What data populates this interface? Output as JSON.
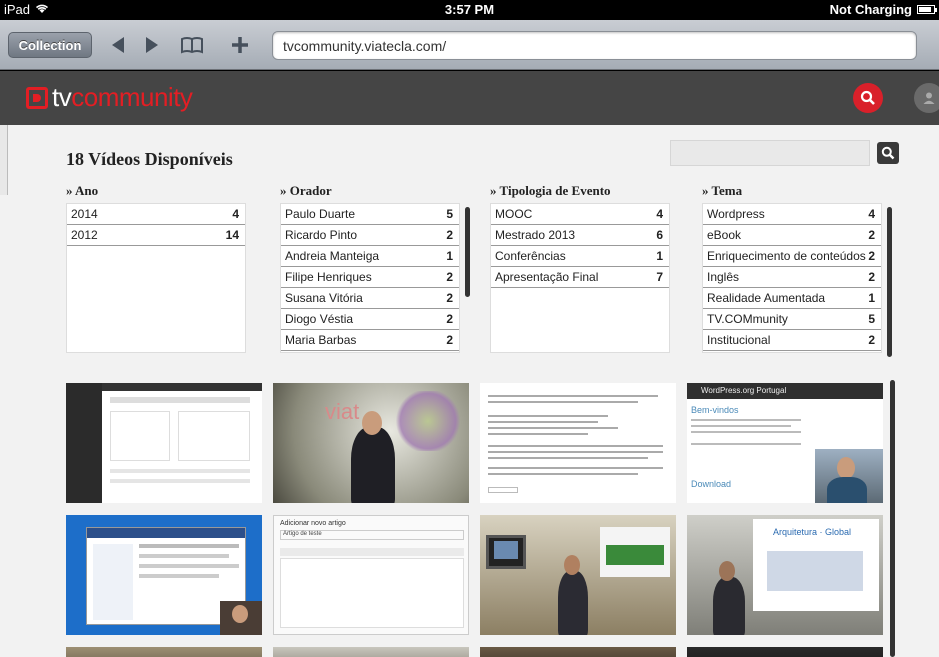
{
  "status_bar": {
    "device": "iPad",
    "time": "3:57 PM",
    "battery_status": "Not Charging"
  },
  "browser": {
    "collection_label": "Collection",
    "url": "tvcommunity.viatecla.com/"
  },
  "site": {
    "logo_prefix": "tv",
    "logo_name": "community",
    "accent_color": "#e31e24"
  },
  "main": {
    "heading": "18 Vídeos Disponíveis",
    "search_placeholder": ""
  },
  "facets": [
    {
      "title": "» Ano",
      "items": [
        {
          "label": "2014",
          "count": "4"
        },
        {
          "label": "2012",
          "count": "14"
        }
      ]
    },
    {
      "title": "» Orador",
      "items": [
        {
          "label": "Paulo Duarte",
          "count": "5"
        },
        {
          "label": "Ricardo Pinto",
          "count": "2"
        },
        {
          "label": "Andreia Manteiga",
          "count": "1"
        },
        {
          "label": "Filipe Henriques",
          "count": "2"
        },
        {
          "label": "Susana Vitória",
          "count": "2"
        },
        {
          "label": "Diogo Véstia",
          "count": "2"
        },
        {
          "label": "Maria Barbas",
          "count": "2"
        }
      ]
    },
    {
      "title": "» Tipologia de Evento",
      "items": [
        {
          "label": "MOOC",
          "count": "4"
        },
        {
          "label": "Mestrado 2013",
          "count": "6"
        },
        {
          "label": "Conferências",
          "count": "1"
        },
        {
          "label": "Apresentação Final",
          "count": "7"
        }
      ]
    },
    {
      "title": "» Tema",
      "items": [
        {
          "label": "Wordpress",
          "count": "4"
        },
        {
          "label": "eBook",
          "count": "2"
        },
        {
          "label": "Enriquecimento de conteúdos",
          "count": "2"
        },
        {
          "label": "Inglês",
          "count": "2"
        },
        {
          "label": "Realidade Aumentada",
          "count": "1"
        },
        {
          "label": "TV.COMmunity",
          "count": "5"
        },
        {
          "label": "Institucional",
          "count": "2"
        }
      ]
    }
  ],
  "thumbnails": {
    "conf_logo_text": "viat",
    "portal_title": "WordPress.org Portugal",
    "portal_section1": "Bem-vindos",
    "portal_section2": "Download",
    "editor_title": "Adicionar novo artigo",
    "editor_field": "Artigo de teste",
    "projector_title": "Arquitetura · Global"
  }
}
